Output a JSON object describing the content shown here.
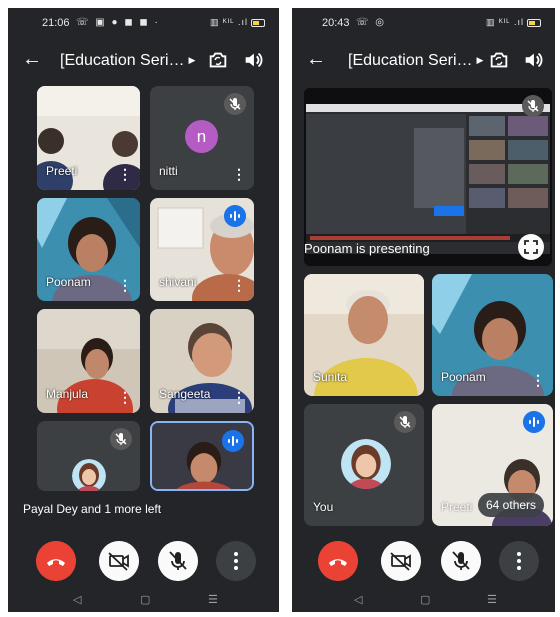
{
  "left_phone": {
    "status": {
      "time": "21:06",
      "icons": "☏ ▣ ● ◼ ◼ ·",
      "right_icons": "▥ ᴷᴵᴸ .ıl"
    },
    "meeting_title": "[Education Seri…",
    "participants": [
      {
        "name": "Preeti",
        "type": "video",
        "mic": "none"
      },
      {
        "name": "nitti",
        "type": "initial",
        "initial": "n",
        "avatar_color": "#b45cc4",
        "mic": "muted"
      },
      {
        "name": "Poonam",
        "type": "video",
        "mic": "none"
      },
      {
        "name": "shivani",
        "type": "video",
        "mic": "speaking"
      },
      {
        "name": "Manjula",
        "type": "video",
        "mic": "none"
      },
      {
        "name": "Sangeeta",
        "type": "video",
        "mic": "none"
      },
      {
        "name": "",
        "type": "photo",
        "mic": "muted"
      },
      {
        "name": "",
        "type": "video",
        "mic": "speaking"
      }
    ],
    "notification": "Payal Dey and 1 more left"
  },
  "right_phone": {
    "status": {
      "time": "20:43",
      "icons": "☏ ◎",
      "right_icons": "▥ ᴷᴵᴸ .ıl"
    },
    "meeting_title": "[Education Seri…",
    "presentation": {
      "label": "Poonam is presenting"
    },
    "participants": [
      {
        "name": "Sunita",
        "type": "video",
        "mic": "none"
      },
      {
        "name": "Poonam",
        "type": "video",
        "mic": "none"
      },
      {
        "name": "You",
        "type": "photo",
        "mic": "muted"
      },
      {
        "name": "Preeti",
        "type": "video",
        "mic": "speaking"
      }
    ],
    "others_badge": "64 others"
  },
  "colors": {
    "background": "#232528",
    "tile": "#3c4043",
    "end_call": "#ea4335",
    "speaking": "#1a73e8"
  },
  "icons": [
    "back-arrow-icon",
    "switch-camera-icon",
    "speaker-icon",
    "mic-off-icon",
    "audio-wave-icon",
    "more-vert-icon",
    "end-call-icon",
    "camera-off-icon",
    "fullscreen-icon",
    "nav-back-icon",
    "nav-home-icon",
    "nav-recents-icon"
  ]
}
